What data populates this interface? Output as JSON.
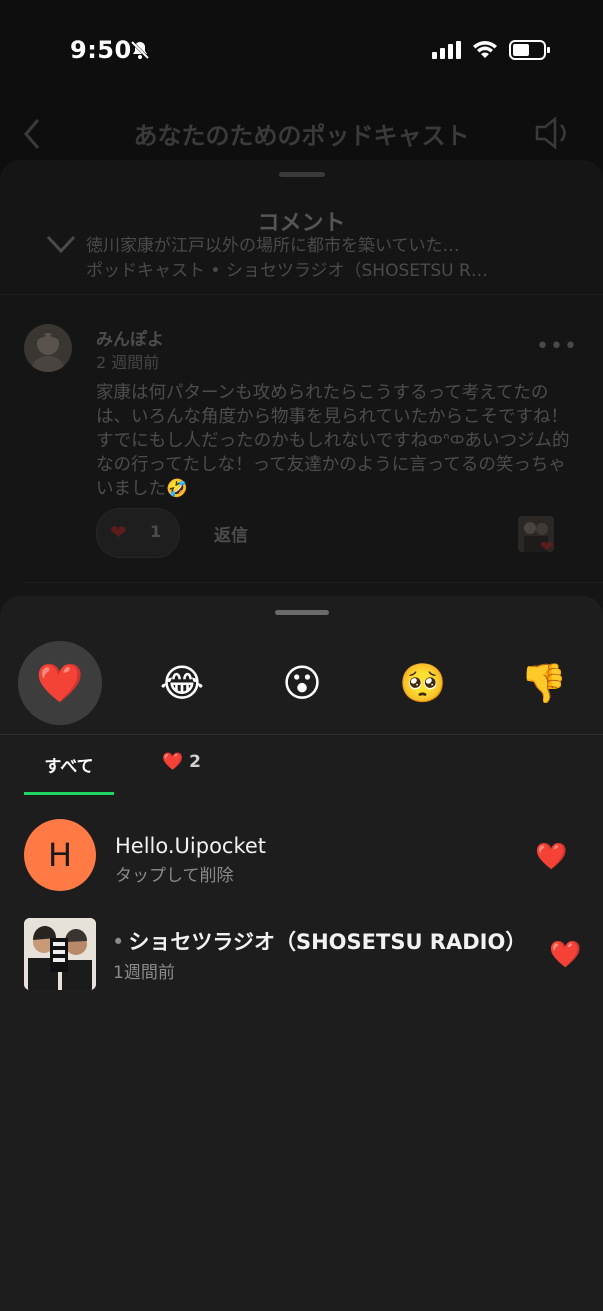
{
  "status_bar": {
    "time": "9:50"
  },
  "nav": {
    "title": "あなたのためのポッドキャスト"
  },
  "comment_sheet": {
    "title": "コメント",
    "episode_title": "徳川家康が江戸以外の場所に都市を築いていた…",
    "episode_subtitle": "ポッドキャスト • ショセツラジオ（SHOSETSU R…",
    "comment": {
      "user": "みんぽよ",
      "time": "2 週間前",
      "more": "•••",
      "body": "家康は何パターンも攻められたらこうするって考えてたのは、いろんな角度から物事を見られていたからこそですね！すでにもし人だったのかもしれないですね𐠗ᐢ𐠗あいつジム的なの行ってたしな！って友達かのように言ってるの笑っちゃいました🤣",
      "like_count": "1",
      "reply_label": "返信"
    }
  },
  "reactions": {
    "emojis": [
      "❤️",
      "😂",
      "😮",
      "🥺",
      "👎"
    ],
    "tabs": [
      {
        "label": "すべて"
      },
      {
        "icon": "❤️",
        "count": "2"
      }
    ],
    "users": [
      {
        "initial": "H",
        "name": "Hello.Uipocket",
        "sub": "タップして削除",
        "reaction": "❤️"
      },
      {
        "name": "ショセツラジオ（SHOSETSU RADIO）",
        "sub": "1週間前",
        "reaction": "❤️"
      }
    ]
  },
  "colors": {
    "accent_green": "#1ed760",
    "heart_red": "#e8202b",
    "avatar_orange": "#ff7a45",
    "sheet_bg": "#1d1d1d"
  }
}
